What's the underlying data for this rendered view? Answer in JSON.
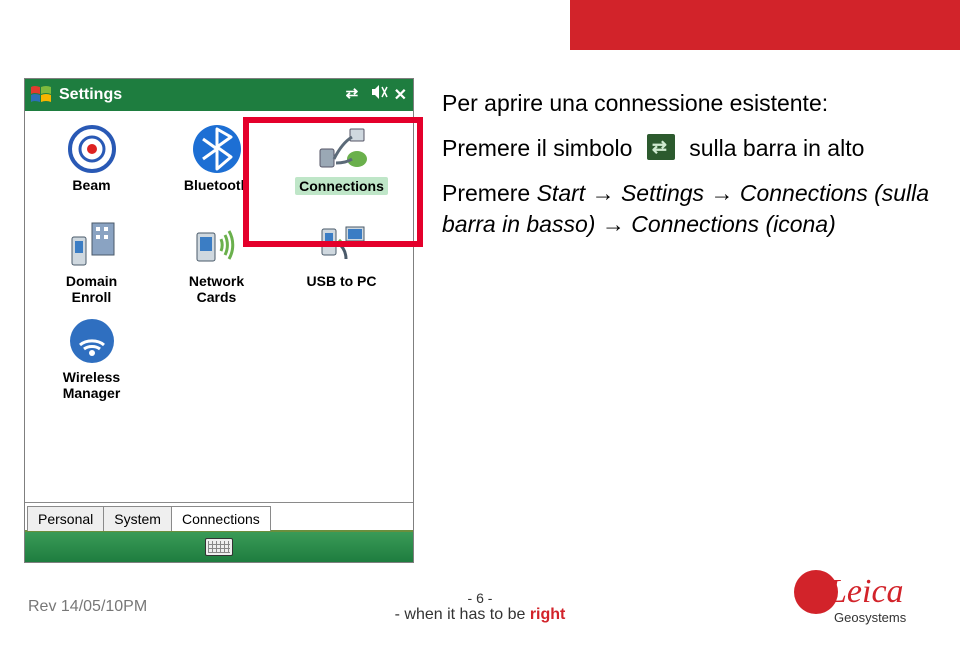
{
  "banner_color": "#d2232a",
  "phone": {
    "title": "Settings",
    "status": {
      "connectivity": "connectivity-icon",
      "volume": "volume-icon",
      "close": "✕"
    },
    "apps": [
      {
        "key": "beam",
        "label": "Beam"
      },
      {
        "key": "bluetooth",
        "label": "Bluetooth"
      },
      {
        "key": "connections",
        "label": "Connections",
        "selected": true
      },
      {
        "key": "domain_enroll",
        "label": "Domain\nEnroll"
      },
      {
        "key": "network_cards",
        "label": "Network\nCards"
      },
      {
        "key": "usb_to_pc",
        "label": "USB to PC"
      },
      {
        "key": "wireless_manager",
        "label": "Wireless\nManager"
      }
    ],
    "tabs": [
      {
        "key": "personal",
        "label": "Personal"
      },
      {
        "key": "system",
        "label": "System"
      },
      {
        "key": "connections",
        "label": "Connections",
        "active": true
      }
    ],
    "bottom_icon": "keyboard-icon"
  },
  "instructions": {
    "line1": "Per aprire una connessione esistente:",
    "line2_a": "Premere il simbolo",
    "line2_b": "sulla barra in alto",
    "line3": "Premere Start → Settings → Connections (sulla barra in basso) → Connections (icona)",
    "line3_html_parts": {
      "a": "Premere ",
      "b": "Start",
      "c": "Settings",
      "d": "Connections (sulla barra in basso)",
      "e": "Connections (icona)"
    }
  },
  "footer": {
    "rev": "Rev 14/05/10PM",
    "page": "- 6 -",
    "motto_a": "- when it has to be ",
    "motto_b": "right",
    "brand_main": "Leica",
    "brand_sub": "Geosystems"
  }
}
